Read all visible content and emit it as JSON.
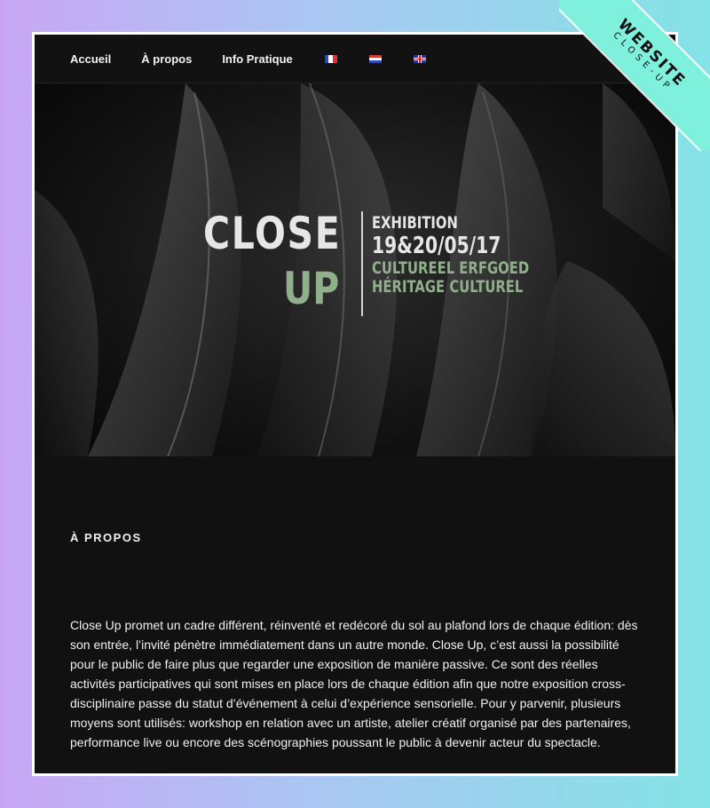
{
  "ribbon": {
    "title": "WEBSITE",
    "subtitle": "CLOSE-UP",
    "color": "#7ff0dc"
  },
  "nav": {
    "items": [
      "Accueil",
      "À propos",
      "Info Pratique"
    ],
    "flags": [
      "fr-flag-icon",
      "nl-flag-icon",
      "uk-flag-icon"
    ]
  },
  "hero": {
    "logo_close": "CLOSE",
    "logo_up": "UP",
    "exhibition": "EXHIBITION",
    "date": "19&20/05/17",
    "line1": "CULTUREEL ERFGOED",
    "line2": "HÉRITAGE CULTUREL",
    "accent_color": "#8fb08a"
  },
  "about": {
    "title": "À PROPOS",
    "text": "Close Up promet un cadre différent, réinventé et redécoré du sol au plafond lors de chaque édition: dès son entrée, l’invité pénètre immédiatement dans un autre monde. Close Up, c’est aussi la possibilité pour le public de faire plus que regarder une exposition de manière passive. Ce sont des réelles activités participatives qui sont mises en place lors de chaque édition afin que notre exposition cross-disciplinaire passe du statut d’événement à celui d’expérience sensorielle. Pour y parvenir, plusieurs moyens sont utilisés: workshop en relation avec un artiste, atelier créatif organisé par des partenaires, performance live ou encore des scénographies poussant le public à devenir acteur du spectacle."
  }
}
